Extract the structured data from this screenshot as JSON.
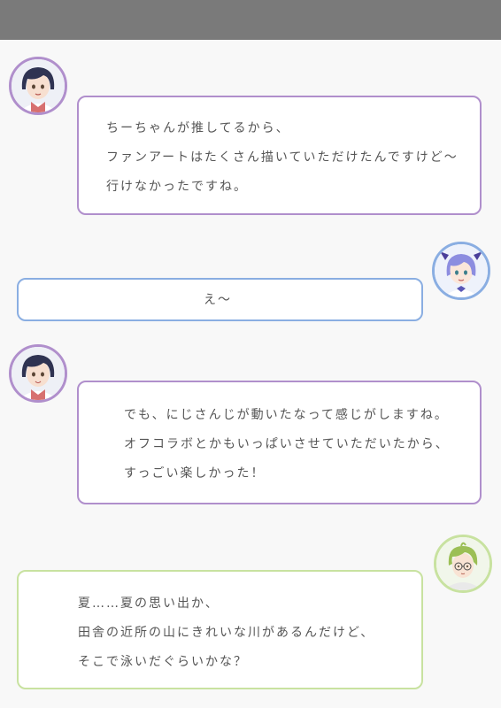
{
  "colors": {
    "top_bar": "#7a7a7a",
    "background": "#f8f8f8",
    "purple_border": "#b08fcc",
    "blue_border": "#8aaee2",
    "green_border": "#c8e2a0",
    "text": "#555555"
  },
  "messages": [
    {
      "speaker_avatar": "dark-blue-haired-girl-avatar",
      "align": "left",
      "border": "purple",
      "lines": [
        "ちーちゃんが推してるから、",
        "ファンアートはたくさん描いていただけたんですけど～",
        "行けなかったですね。"
      ]
    },
    {
      "speaker_avatar": "purple-twintail-girl-avatar",
      "align": "right",
      "border": "blue",
      "lines": [
        "え～"
      ]
    },
    {
      "speaker_avatar": "dark-blue-haired-girl-avatar",
      "align": "left",
      "border": "purple",
      "lines": [
        "でも、にじさんじが動いたなって感じがしますね。",
        "オフコラボとかもいっぱいさせていただいたから、",
        "すっごい楽しかった！"
      ]
    },
    {
      "speaker_avatar": "green-haired-glasses-boy-avatar",
      "align": "right",
      "border": "green",
      "lines": [
        "夏……夏の思い出か、",
        "田舎の近所の山にきれいな川があるんだけど、",
        "そこで泳いだぐらいかな？"
      ]
    }
  ]
}
